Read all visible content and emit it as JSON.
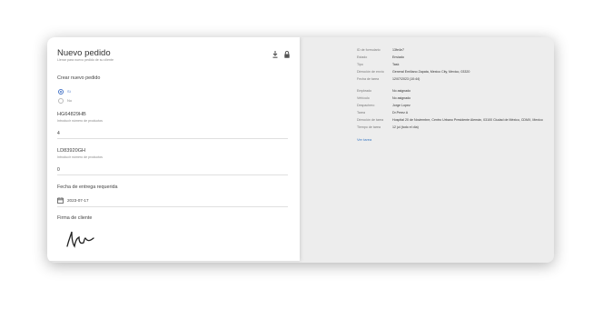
{
  "form": {
    "title": "Nuevo pedido",
    "subtitle": "Llenar para nuevo pedido de su cliente",
    "section_label": "Crear nuevo pedido",
    "options": [
      {
        "label": "Sí",
        "checked": true
      },
      {
        "label": "No",
        "checked": false
      }
    ],
    "items": [
      {
        "code": "HG64829HB",
        "hint": "Introducir número de productos",
        "quantity": "4"
      },
      {
        "code": "LD83920GH",
        "hint": "Introducir número de productos",
        "quantity": "0"
      }
    ],
    "date_label": "Fecha de entrega requerida",
    "date_value": "2023-07-17",
    "signature_label": "Firma de cliente"
  },
  "details": {
    "rows_primary": [
      {
        "key": "ID de formulario",
        "value": "13fe4e7"
      },
      {
        "key": "Estado",
        "value": "Enviado"
      },
      {
        "key": "Tipo",
        "value": "Task"
      },
      {
        "key": "Dirección de envío",
        "value": "General Emiliano Zapata, Mexico City, Mexico, 03320"
      },
      {
        "key": "Fecha de tarea",
        "value": "12/07/2023 (10:44)"
      }
    ],
    "rows_secondary": [
      {
        "key": "Empleado",
        "value": "No asignado"
      },
      {
        "key": "Vehículo",
        "value": "No asignado"
      },
      {
        "key": "Despachero",
        "value": "Jorge Lopez"
      },
      {
        "key": "Tarea",
        "value": "Dr.Perez A"
      },
      {
        "key": "Dirección de tarea",
        "value": "Hospital 20 de Noviembre, Centro Urbano Presidente Alemán, 03100 Ciudad de México, CDMX, Mexico"
      },
      {
        "key": "Tiempo de tarea",
        "value": "12 jul (todo el día)"
      }
    ],
    "link_label": "Ver tarea"
  },
  "colors": {
    "accent": "#4a78c8",
    "link": "#3b79c3",
    "panel_bg": "#ededed",
    "card_bg": "#ffffff"
  }
}
